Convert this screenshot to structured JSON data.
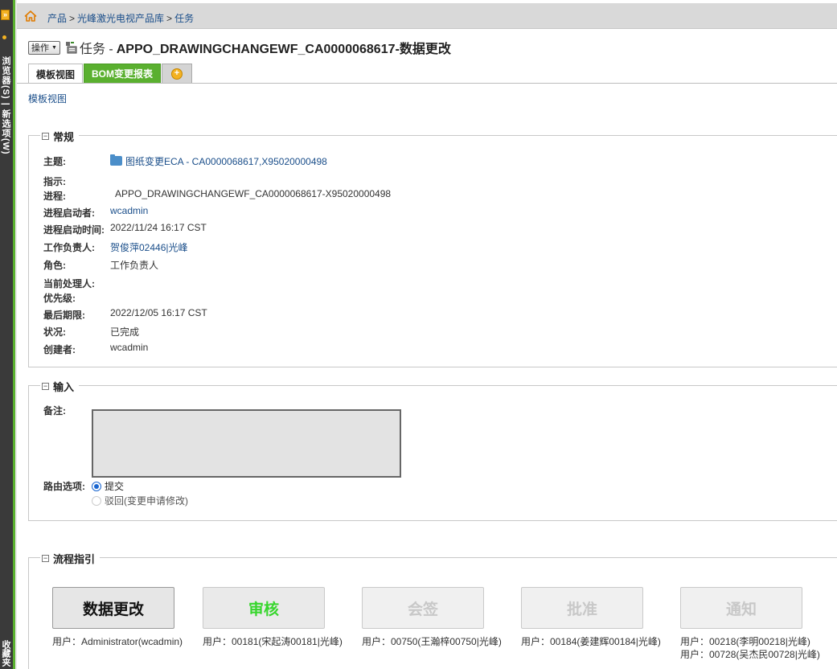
{
  "rail": {
    "button_label": "»",
    "vertical_text": "浏览器(S) | 新选项(W)",
    "vertical_text_bottom": "收藏夹"
  },
  "breadcrumb": {
    "items": [
      "产品",
      "光峰激光电视产品库",
      "任务"
    ],
    "separator": ">"
  },
  "title": {
    "ops_label": "操作",
    "prefix": "任务 -",
    "name": "APPO_DRAWINGCHANGEWF_CA0000068617-数据更改"
  },
  "tabs": [
    {
      "label": "模板视图"
    },
    {
      "label": "BOM变更报表"
    }
  ],
  "view_link": "模板视图",
  "general": {
    "legend": "常规",
    "fields": [
      {
        "label": "主题:",
        "value": "图纸变更ECA - CA0000068617,X95020000498"
      },
      {
        "label": "指示:",
        "value": ""
      },
      {
        "label": "进程:",
        "value": "APPO_DRAWINGCHANGEWF_CA0000068617-X95020000498"
      },
      {
        "label": "进程启动者:",
        "value": "wcadmin"
      },
      {
        "label": "进程启动时间:",
        "value": "2022/11/24 16:17 CST"
      },
      {
        "label": "工作负责人:",
        "value": "贺俊萍02446|光峰"
      },
      {
        "label": "角色:",
        "value": "工作负责人"
      },
      {
        "label": "当前处理人:",
        "value": ""
      },
      {
        "label": "优先级:",
        "value": ""
      },
      {
        "label": "最后期限:",
        "value": "2022/12/05 16:17 CST"
      },
      {
        "label": "状况:",
        "value": "已完成"
      },
      {
        "label": "创建者:",
        "value": "wcadmin"
      }
    ]
  },
  "input": {
    "legend": "输入",
    "comment_label": "备注:",
    "routing_label": "路由选项:",
    "options": [
      "提交",
      "驳回(变更申请修改)"
    ],
    "selected_option": "提交"
  },
  "flow": {
    "legend": "流程指引",
    "steps": [
      {
        "label": "数据更改",
        "users": [
          "用户：Administrator(wcadmin)"
        ]
      },
      {
        "label": "审核",
        "users": [
          "用户：00181(宋起涛00181|光峰)"
        ]
      },
      {
        "label": "会签",
        "users": [
          "用户：00750(王瀚梓00750|光峰)"
        ]
      },
      {
        "label": "批准",
        "users": [
          "用户：00184(姜建辉00184|光峰)"
        ]
      },
      {
        "label": "通知",
        "users": [
          "用户：00218(李明00218|光峰)",
          "用户：00728(吴杰民00728|光峰)"
        ]
      }
    ]
  },
  "colors": {
    "accent_green": "#5ab02f",
    "link_blue": "#1a4e8a",
    "review_green": "#36d62c"
  }
}
